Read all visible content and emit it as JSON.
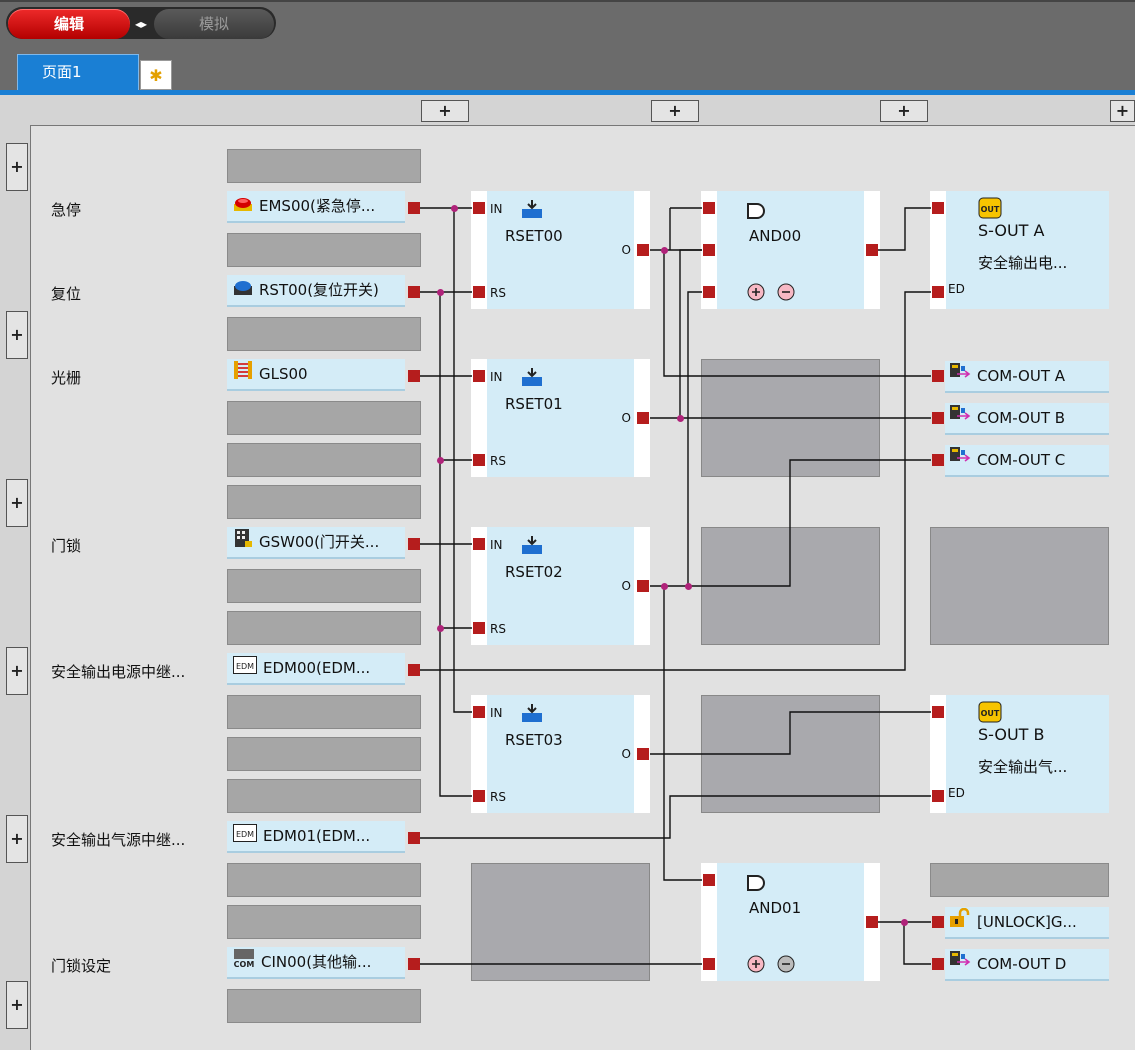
{
  "toolbar": {
    "edit_label": "编辑",
    "sim_label": "模拟",
    "toggle_glyph": "◂▸"
  },
  "tabs": {
    "page1": "页面1",
    "new_glyph": "✱"
  },
  "plus_glyph": "+",
  "rows": {
    "emergency_stop": "急停",
    "reset": "复位",
    "light_curtain": "光栅",
    "door_lock": "门锁",
    "edm_power": "安全输出电源中继...",
    "edm_air": "安全输出气源中继...",
    "door_lock_setting": "门锁设定"
  },
  "devices": {
    "ems00": "EMS00(紧急停...",
    "rst00": "RST00(复位开关)",
    "gls00": "GLS00",
    "gsw00": "GSW00(门开关...",
    "edm00": "EDM00(EDM...",
    "edm01": "EDM01(EDM...",
    "cin00": "CIN00(其他输..."
  },
  "ports": {
    "in": "IN",
    "rs": "RS",
    "o": "O",
    "ed": "ED"
  },
  "blocks": {
    "rset00": "RSET00",
    "rset01": "RSET01",
    "rset02": "RSET02",
    "rset03": "RSET03",
    "and00": "AND00",
    "and01": "AND01"
  },
  "outputs": {
    "sout_a_title": "S-OUT A",
    "sout_a_desc": "安全输出电...",
    "sout_b_title": "S-OUT B",
    "sout_b_desc": "安全输出气...",
    "com_out_a": "COM-OUT A",
    "com_out_b": "COM-OUT B",
    "com_out_c": "COM-OUT C",
    "com_out_d": "COM-OUT D",
    "unlock": "[UNLOCK]G..."
  },
  "icons": {
    "out_badge": "OUT",
    "edm_badge": "EDM",
    "com_badge": "COM"
  },
  "colors": {
    "accent": "#1a7fd4",
    "port": "#b51d1d",
    "junction": "#b0237a",
    "edit": "#d40000"
  }
}
